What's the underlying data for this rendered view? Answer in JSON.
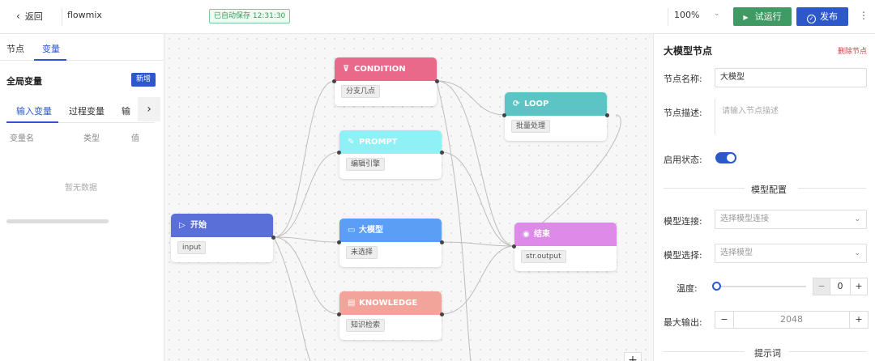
{
  "topbar": {
    "back_label": "返回",
    "app_name": "flowmix",
    "saved_status": "已自动保存 12:31:30",
    "zoom": "100%",
    "run_label": "试运行",
    "publish_label": "发布"
  },
  "left_panel": {
    "tabs": [
      {
        "label": "节点"
      },
      {
        "label": "变量"
      }
    ],
    "global_vars_title": "全局变量",
    "new_button": "新增",
    "var_tabs": [
      {
        "label": "输入变量"
      },
      {
        "label": "过程变量"
      },
      {
        "label": "输"
      }
    ],
    "columns": [
      "变量名",
      "类型",
      "值"
    ],
    "empty_text": "暂无数据"
  },
  "canvas": {
    "nodes": {
      "condition": {
        "title": "CONDITION",
        "chip": "分支几点",
        "color": "#e8698a",
        "icon": "filter-icon"
      },
      "prompt": {
        "title": "PROMPT",
        "chip": "编辑引擎",
        "color": "#8ff0f5",
        "icon": "pencil-icon"
      },
      "llm": {
        "title": "大模型",
        "chip": "未选择",
        "color": "#5b9ef5",
        "icon": "chat-icon"
      },
      "knowledge": {
        "title": "KNOWLEDGE",
        "chip": "知识检索",
        "color": "#f2a49a",
        "icon": "book-icon"
      },
      "loop": {
        "title": "LOOP",
        "chip": "批量处理",
        "color": "#5cc4c4",
        "icon": "loop-icon"
      },
      "start": {
        "title": "开始",
        "chip": "input",
        "color": "#5a6fd8",
        "icon": "play-icon"
      },
      "end": {
        "title": "结束",
        "chip": "str.output",
        "color": "#de8ae8",
        "icon": "stop-icon"
      }
    }
  },
  "right_panel": {
    "title": "大模型节点",
    "delete_label": "删除节点",
    "name_label": "节点名称:",
    "name_value": "大模型",
    "desc_label": "节点描述:",
    "desc_placeholder": "请输入节点描述",
    "enabled_label": "启用状态:",
    "enabled": true,
    "model_section": "模型配置",
    "conn_label": "模型连接:",
    "conn_placeholder": "选择模型连接",
    "model_label": "模型选择:",
    "model_placeholder": "选择模型",
    "temp_label": "温度:",
    "temp_value": "0",
    "max_label": "最大输出:",
    "max_value": "2048",
    "prompt_section": "提示词"
  }
}
